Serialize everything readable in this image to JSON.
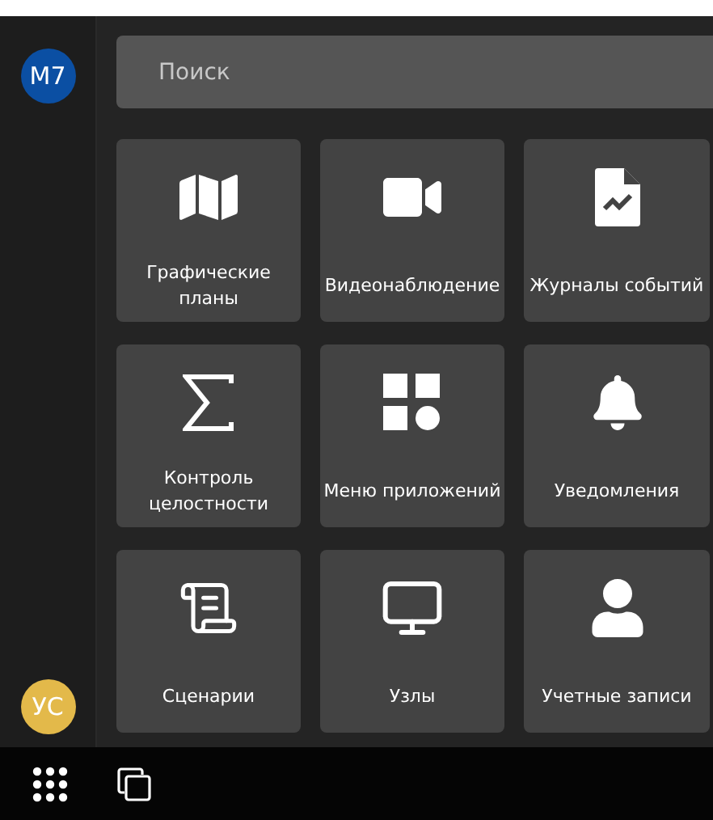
{
  "sidebar": {
    "top_avatar": {
      "initials": "M7",
      "color": "#0b4fa3"
    },
    "bottom_avatar": {
      "initials": "УС",
      "color": "#e3b94a"
    }
  },
  "search": {
    "placeholder": "Поиск"
  },
  "tiles": [
    {
      "label": "Графические планы"
    },
    {
      "label": "Видеонаблюдение"
    },
    {
      "label": "Журналы событий"
    },
    {
      "label": "Контроль целостности"
    },
    {
      "label": "Меню приложений"
    },
    {
      "label": "Уведомления"
    },
    {
      "label": "Сценарии"
    },
    {
      "label": "Узлы"
    },
    {
      "label": "Учетные записи"
    }
  ]
}
